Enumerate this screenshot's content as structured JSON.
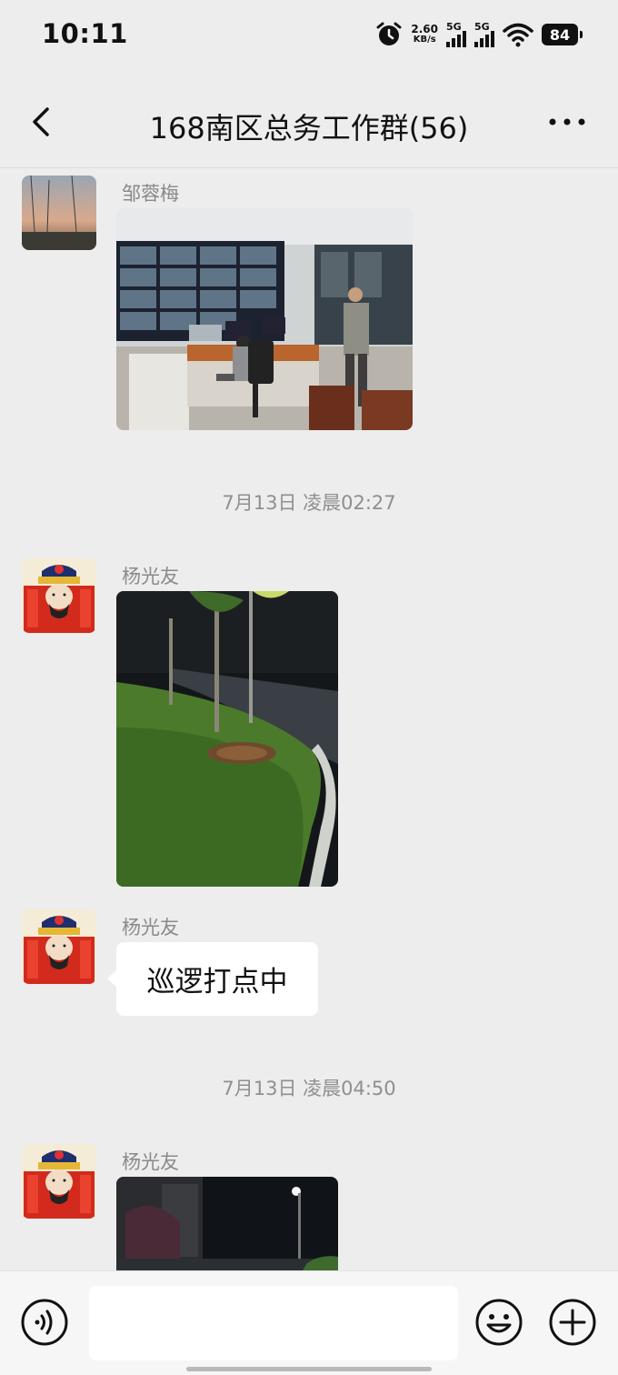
{
  "status_bar": {
    "time": "10:11",
    "net_speed_value": "2.60",
    "net_speed_unit": "KB/s",
    "signal1": "5G",
    "signal2": "5G",
    "battery": "84"
  },
  "nav": {
    "title": "168南区总务工作群(56)"
  },
  "messages": [
    {
      "sender": "邹蓉梅",
      "type": "image",
      "image_desc": "surveillance-room-photo"
    },
    {
      "timestamp": "7月13日 凌晨02:27"
    },
    {
      "sender": "杨光友",
      "type": "image",
      "image_desc": "night-patrol-lawn-photo"
    },
    {
      "sender": "杨光友",
      "type": "text",
      "text": "巡逻打点中"
    },
    {
      "timestamp": "7月13日 凌晨04:50"
    },
    {
      "sender": "杨光友",
      "type": "image",
      "image_desc": "night-street-photo"
    }
  ],
  "input_bar": {
    "input_value": "",
    "icons": [
      "voice-icon",
      "emoji-icon",
      "plus-icon"
    ]
  },
  "colors": {
    "background": "#ededed",
    "bubble": "#ffffff",
    "meta_text": "#8f8f8f"
  }
}
